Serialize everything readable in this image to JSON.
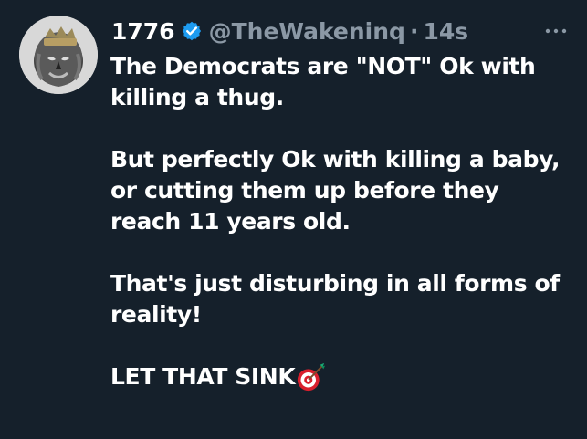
{
  "tweet": {
    "display_name": "1776",
    "handle": "@TheWakeninq",
    "separator": "·",
    "timestamp": "14s",
    "verified_icon": "verified-badge-icon",
    "more_icon": "more-options-icon",
    "avatar_icon": "lion-crown-avatar",
    "paragraphs": [
      "The Democrats are \"NOT\" Ok with killing a thug.",
      "But perfectly Ok with killing a baby, or cutting them up before they reach 11 years old.",
      "That's just disturbing in all forms of reality!"
    ],
    "closing_text": "LET THAT SINK",
    "closing_emoji": "target-dart-emoji"
  },
  "colors": {
    "background": "#15202b",
    "text_primary": "#ffffff",
    "text_secondary": "#8b98a5",
    "verified": "#1d9bf0"
  }
}
